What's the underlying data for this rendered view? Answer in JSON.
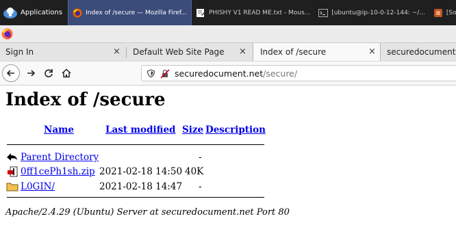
{
  "taskbar": {
    "applications_label": "Applications",
    "tasks": [
      {
        "label": "Index of /secure — Mozilla Firef...",
        "active": true,
        "icon": "firefox-icon"
      },
      {
        "label": "PHISHY V1 READ ME.txt - Mous...",
        "active": false,
        "icon": "text-editor-icon"
      },
      {
        "label": "[ubuntu@ip-10-0-12-144: ~/...",
        "active": false,
        "icon": "terminal-icon"
      },
      {
        "label": "[Software U",
        "active": false,
        "icon": "software-updater-icon"
      }
    ]
  },
  "browser": {
    "tabs": [
      {
        "label": "Sign In",
        "active": false
      },
      {
        "label": "Default Web Site Page",
        "active": false
      },
      {
        "label": "Index of /secure",
        "active": true
      },
      {
        "label": "securedocument.n",
        "active": false
      }
    ],
    "close_glyph": "×",
    "url_host": "securedocument.net",
    "url_path": "/secure/"
  },
  "page": {
    "title": "Index of /secure",
    "columns": {
      "name": "Name",
      "modified": "Last modified",
      "size": "Size",
      "description": "Description"
    },
    "rows": [
      {
        "icon": "back-arrow-icon",
        "name": "Parent Directory",
        "modified": "",
        "size": "-",
        "description": ""
      },
      {
        "icon": "compressed-file-icon",
        "name": "0ff1cePh1sh.zip",
        "modified": "2021-02-18 14:50",
        "size": "40K",
        "description": ""
      },
      {
        "icon": "folder-icon",
        "name": "L0GIN/",
        "modified": "2021-02-18 14:47",
        "size": "-",
        "description": ""
      }
    ],
    "footer": "Apache/2.4.29 (Ubuntu) Server at securedocument.net Port 80"
  },
  "colors": {
    "link": "#0000ee",
    "taskbar_bg": "#1f1f1f",
    "active_task": "#3b4c7a"
  }
}
